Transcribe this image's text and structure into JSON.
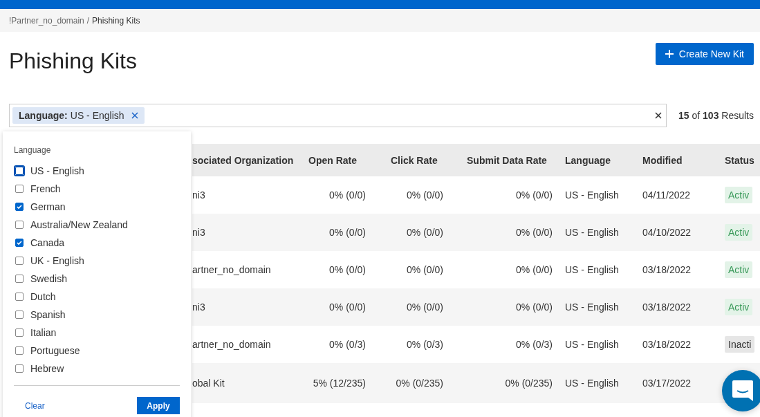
{
  "breadcrumb": {
    "parent": "!Partner_no_domain",
    "separator": "/",
    "current": "Phishing Kits"
  },
  "title": "Phishing Kits",
  "create_button": {
    "label": "Create New Kit"
  },
  "filter": {
    "chip_label": "Language:",
    "chip_value": "US - English",
    "results": "**15** of **103** Results"
  },
  "dropdown": {
    "heading": "Language",
    "options": [
      {
        "label": "US - English",
        "checked": false,
        "focused": true
      },
      {
        "label": "French",
        "checked": false,
        "focused": false
      },
      {
        "label": "German",
        "checked": true,
        "focused": false
      },
      {
        "label": "Australia/New Zealand",
        "checked": false,
        "focused": false
      },
      {
        "label": "Canada",
        "checked": true,
        "focused": false
      },
      {
        "label": "UK - English",
        "checked": false,
        "focused": false
      },
      {
        "label": "Swedish",
        "checked": false,
        "focused": false
      },
      {
        "label": "Dutch",
        "checked": false,
        "focused": false
      },
      {
        "label": "Spanish",
        "checked": false,
        "focused": false
      },
      {
        "label": "Italian",
        "checked": false,
        "focused": false
      },
      {
        "label": "Portuguese",
        "checked": false,
        "focused": false
      },
      {
        "label": "Hebrew",
        "checked": false,
        "focused": false
      }
    ],
    "clear": "Clear",
    "apply": "Apply"
  },
  "table": {
    "columns": [
      "sociated Organization",
      "Open Rate",
      "Click Rate",
      "Submit Data Rate",
      "Language",
      "Modified",
      "Status"
    ],
    "rows": [
      {
        "cells": [
          "ni3",
          "0% (0/0)",
          "0% (0/0)",
          "0% (0/0)",
          "US - English",
          "04/11/2022"
        ],
        "status": "Activ",
        "active": true
      },
      {
        "cells": [
          "ni3",
          "0% (0/0)",
          "0% (0/0)",
          "0% (0/0)",
          "US - English",
          "04/10/2022"
        ],
        "status": "Activ",
        "active": true
      },
      {
        "cells": [
          "artner_no_domain",
          "0% (0/0)",
          "0% (0/0)",
          "0% (0/0)",
          "US - English",
          "03/18/2022"
        ],
        "status": "Activ",
        "active": true
      },
      {
        "cells": [
          "ni3",
          "0% (0/0)",
          "0% (0/0)",
          "0% (0/0)",
          "US - English",
          "03/18/2022"
        ],
        "status": "Activ",
        "active": true
      },
      {
        "cells": [
          "artner_no_domain",
          "0% (0/3)",
          "0% (0/3)",
          "0% (0/3)",
          "US - English",
          "03/18/2022"
        ],
        "status": "Inacti",
        "active": false
      },
      {
        "cells": [
          "obal Kit",
          "5% (12/235)",
          "0% (0/235)",
          "0% (0/235)",
          "US - English",
          "03/17/2022"
        ],
        "status": "",
        "active": null
      }
    ]
  }
}
